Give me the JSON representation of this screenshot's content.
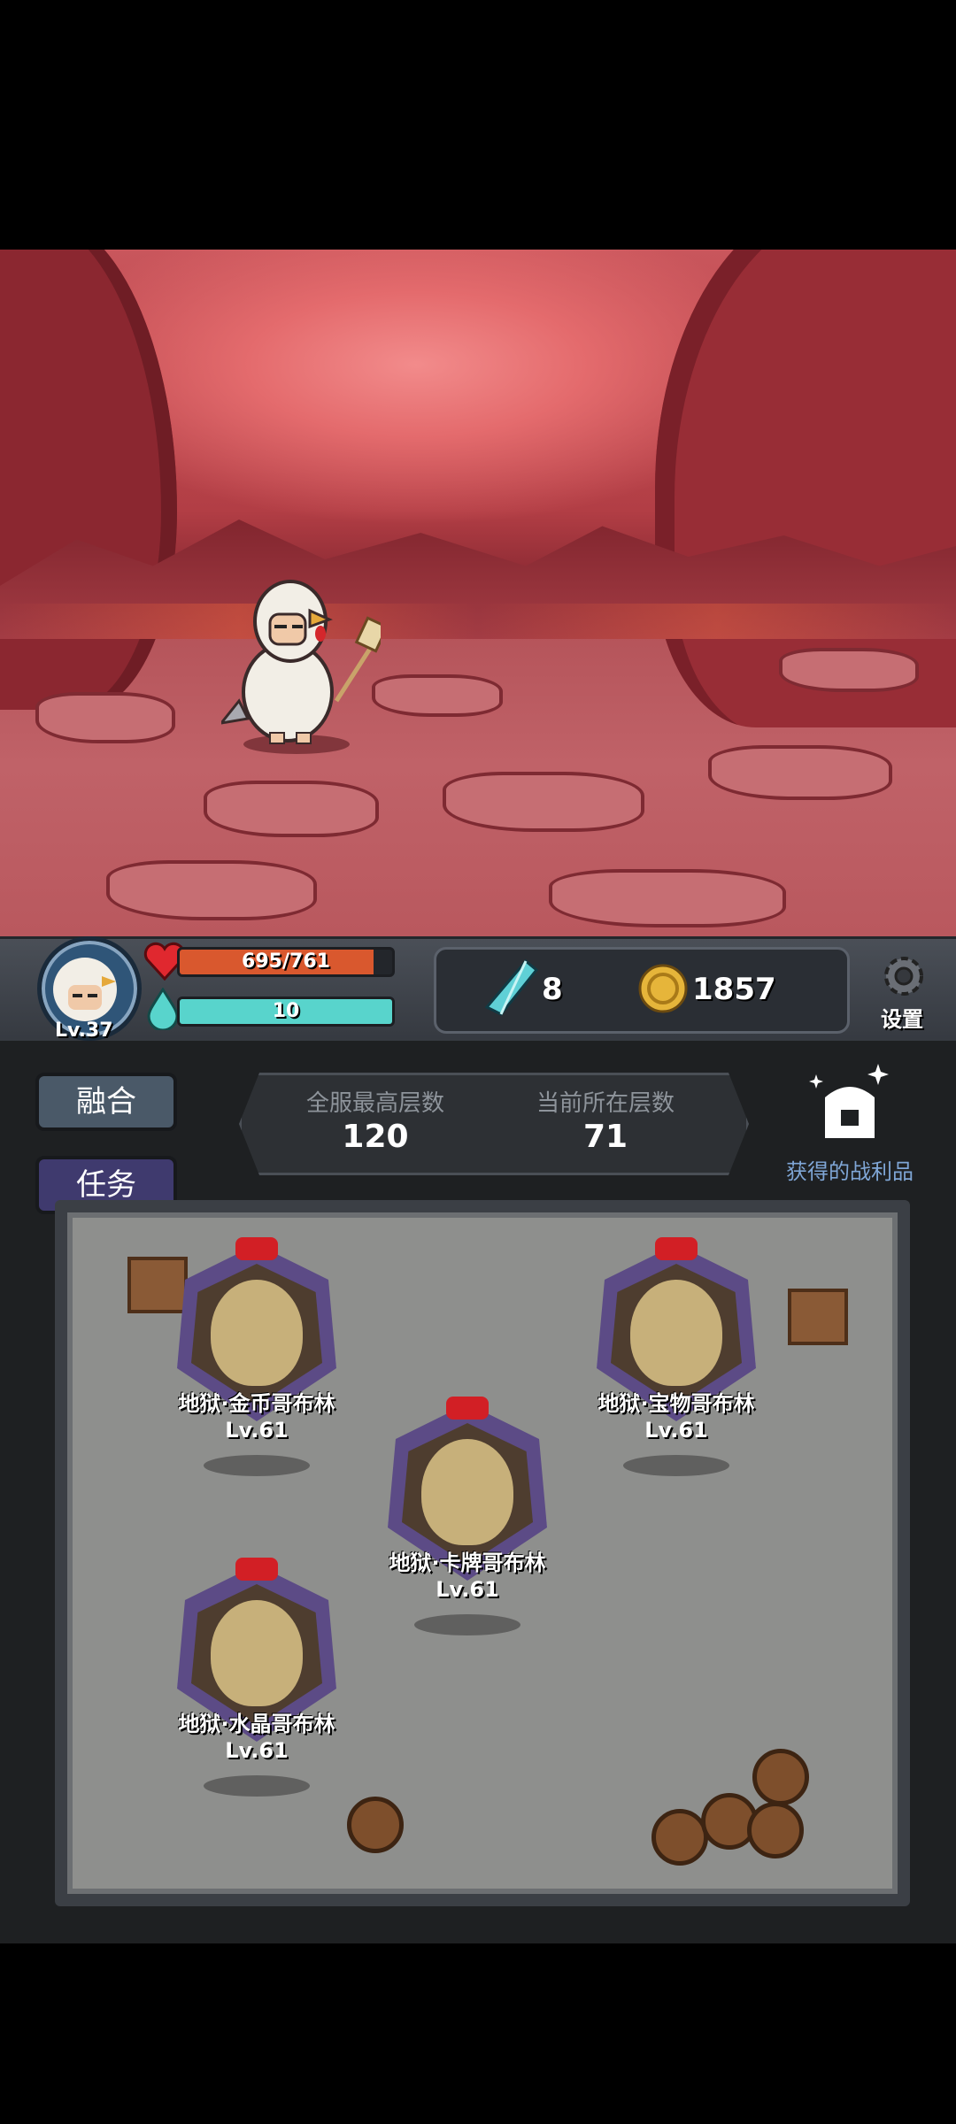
{
  "player": {
    "level": "Lv.37"
  },
  "stats": {
    "hp_text": "695/761",
    "hp_fraction": 0.913,
    "mana_text": "10",
    "mana_fraction": 1.0
  },
  "resources": {
    "gems": "8",
    "gold": "1857"
  },
  "settings_label": "设置",
  "buttons": {
    "fusion": "融合",
    "tasks": "任务"
  },
  "floor": {
    "best_label": "全服最高层数",
    "best_value": "120",
    "current_label": "当前所在层数",
    "current_value": "71"
  },
  "loot_label": "获得的战利品",
  "enemies": [
    {
      "name": "地狱·金币哥布林",
      "level": "Lv.61"
    },
    {
      "name": "地狱·宝物哥布林",
      "level": "Lv.61"
    },
    {
      "name": "地狱·卡牌哥布林",
      "level": "Lv.61"
    },
    {
      "name": "地狱·水晶哥布林",
      "level": "Lv.61"
    }
  ],
  "colors": {
    "hp": "#d9582e",
    "mana": "#58d4cc",
    "fusion_button": "#4a5968",
    "tasks_button": "#3f3a6e",
    "gem": "#5fd0d6",
    "gold": "#e6b53a"
  }
}
